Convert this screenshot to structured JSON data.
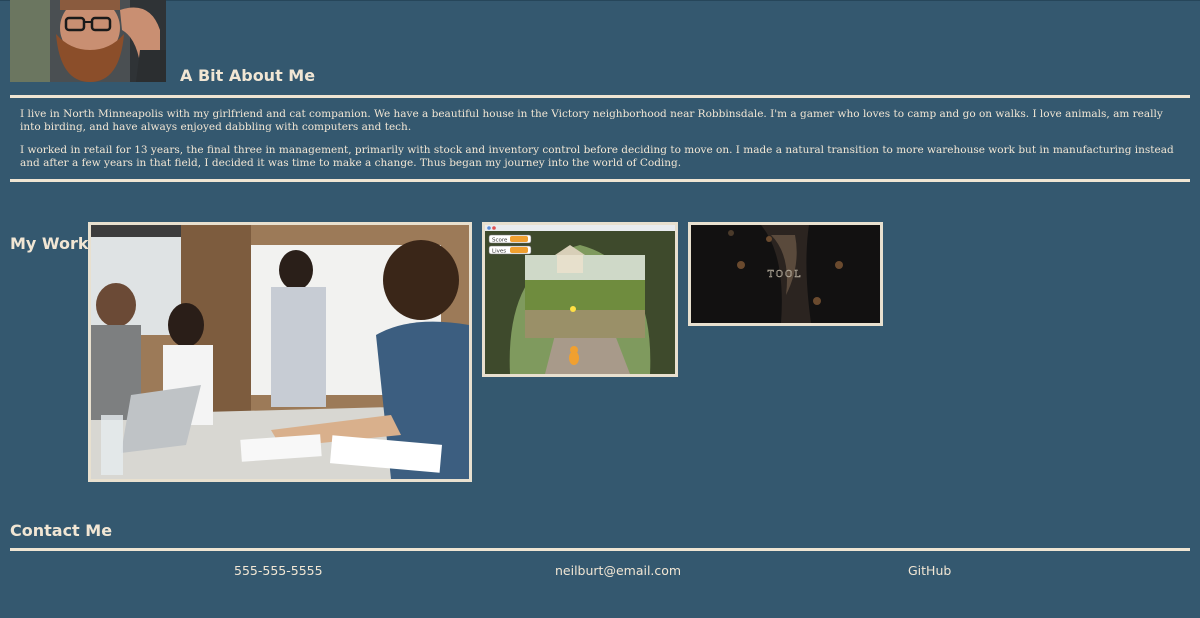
{
  "about": {
    "title": "A Bit About Me",
    "paragraphs": [
      "I live in North Minneapolis with my girlfriend and cat companion. We have a beautiful house in the Victory neighborhood near Robbinsdale. I'm a gamer who loves to camp and go on walks. I love animals, am really into birding, and have always enjoyed dabbling with computers and tech.",
      "I worked in retail for 13 years, the final three in management, primarily with stock and inventory control before deciding to move on. I made a natural transition to more warehouse work but in manufacturing instead and after a few years in that field, I decided it was time to make a change. Thus began my journey into the world of Coding."
    ]
  },
  "work": {
    "title": "My Work",
    "game": {
      "score_label": "Score",
      "lives_label": "Lives"
    },
    "tool": {
      "logo_text": "TOOL"
    }
  },
  "contact": {
    "title": "Contact Me",
    "phone": "555-555-5555",
    "email": "neilburt@email.com",
    "github": "GitHub"
  },
  "colors": {
    "background": "#34586f",
    "text": "#f1e6d4",
    "rule": "#efe5d3"
  }
}
